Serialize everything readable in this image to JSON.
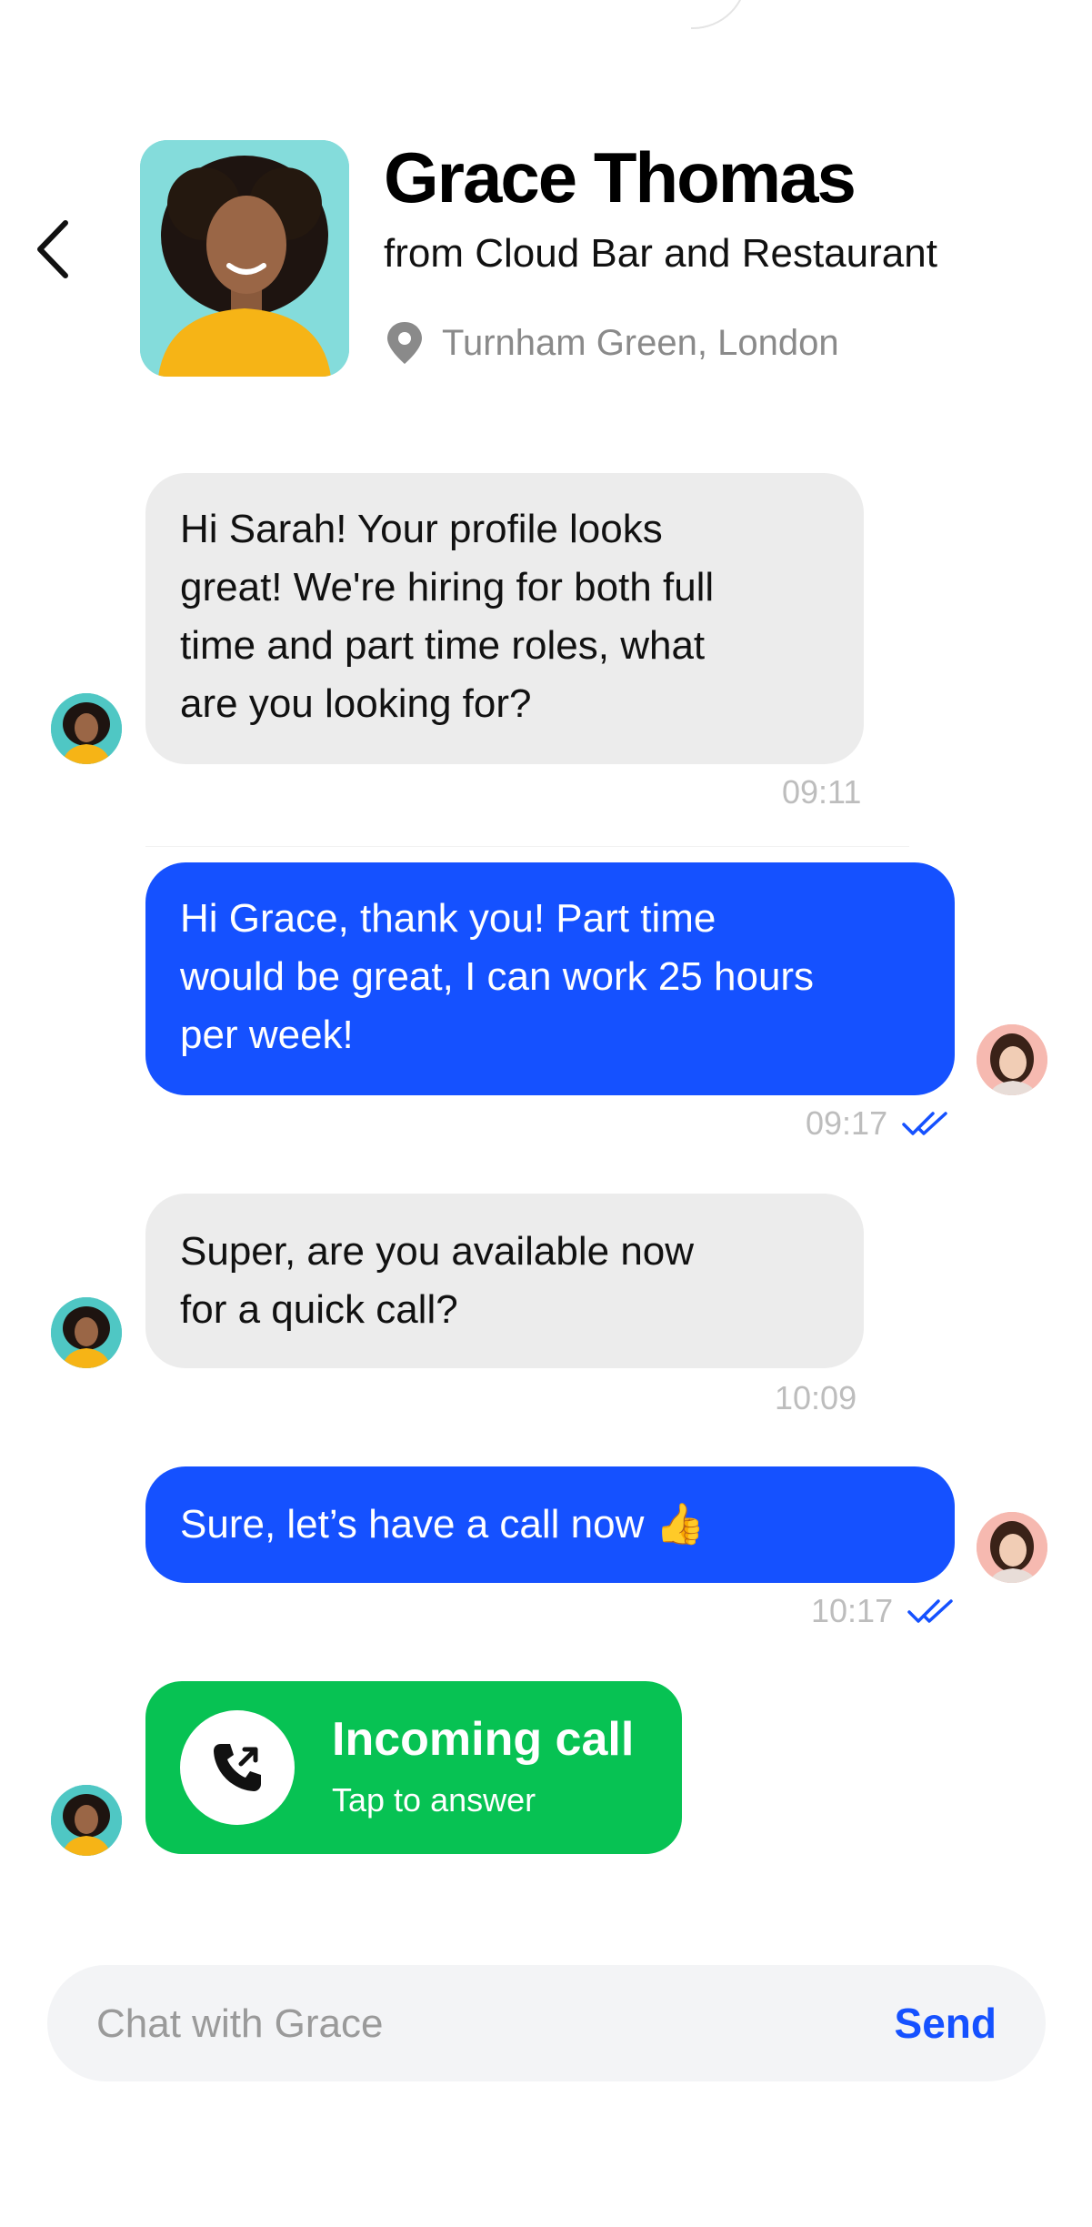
{
  "header": {
    "name": "Grace Thomas",
    "company": "from Cloud Bar and Restaurant",
    "location": "Turnham Green, London",
    "back_icon": "chevron-left-icon",
    "location_icon": "map-pin-icon"
  },
  "messages": [
    {
      "sender": "Grace",
      "direction": "incoming",
      "lines": [
        "Hi Sarah! Your profile looks",
        "great! We're hiring for both full",
        "time and part time roles, what",
        "are you looking for?"
      ],
      "time": "09:11"
    },
    {
      "sender": "Sarah",
      "direction": "outgoing",
      "lines": [
        "Hi Grace, thank you! Part time",
        "would be great, I can work 25 hours",
        "per week!"
      ],
      "time": "09:17",
      "status": "read"
    },
    {
      "sender": "Grace",
      "direction": "incoming",
      "lines": [
        "Super, are you available now",
        "for a quick call?"
      ],
      "time": "10:09"
    },
    {
      "sender": "Sarah",
      "direction": "outgoing",
      "lines": [
        "Sure, let’s have a call now 👍"
      ],
      "time": "10:17",
      "status": "read"
    }
  ],
  "incoming_call": {
    "title": "Incoming call",
    "subtitle": "Tap to answer",
    "icon": "phone-incoming-icon"
  },
  "composer": {
    "placeholder": "Chat with Grace",
    "value": "",
    "send_label": "Send"
  },
  "colors": {
    "accent": "#1551ff",
    "incoming_bubble": "#ececec",
    "call_green": "#07c253",
    "timestamp": "#bdbdbd"
  }
}
